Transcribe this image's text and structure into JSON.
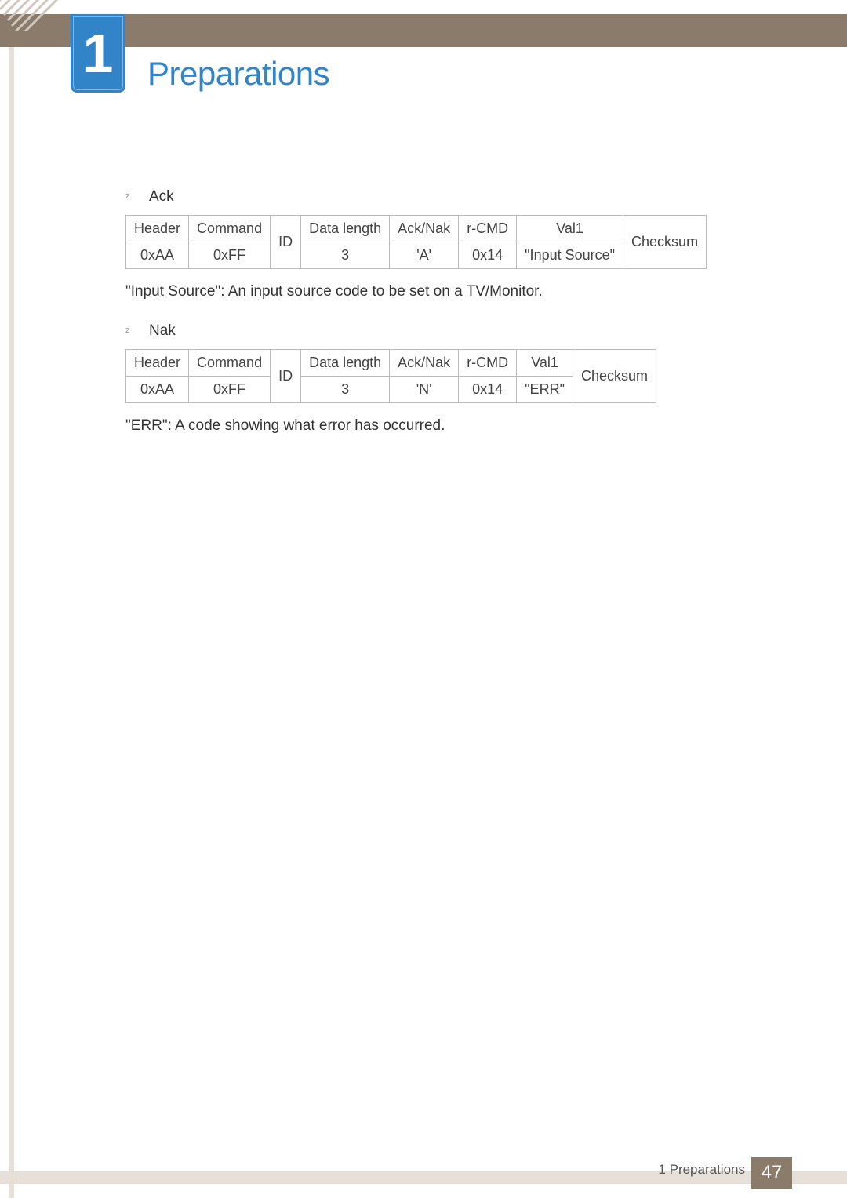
{
  "header": {
    "chapter_number": "1",
    "title": "Preparations"
  },
  "sections": {
    "ack": {
      "label": "Ack",
      "bullet": "z",
      "table": {
        "headers": {
          "header": "Header",
          "command": "Command",
          "id": "ID",
          "data_length": "Data length",
          "ack_nak": "Ack/Nak",
          "r_cmd": "r-CMD",
          "val1": "Val1",
          "checksum": "Checksum"
        },
        "values": {
          "header": "0xAA",
          "command": "0xFF",
          "data_length": "3",
          "ack_nak": "'A'",
          "r_cmd": "0x14",
          "val1": "\"Input Source\""
        }
      },
      "description": "\"Input Source\": An input source code to be set on a TV/Monitor."
    },
    "nak": {
      "label": "Nak",
      "bullet": "z",
      "table": {
        "headers": {
          "header": "Header",
          "command": "Command",
          "id": "ID",
          "data_length": "Data length",
          "ack_nak": "Ack/Nak",
          "r_cmd": "r-CMD",
          "val1": "Val1",
          "checksum": "Checksum"
        },
        "values": {
          "header": "0xAA",
          "command": "0xFF",
          "data_length": "3",
          "ack_nak": "'N'",
          "r_cmd": "0x14",
          "val1": "\"ERR\""
        }
      },
      "description": "\"ERR\": A code showing what error has occurred."
    }
  },
  "footer": {
    "section_label": "1 Preparations",
    "page_number": "47"
  }
}
